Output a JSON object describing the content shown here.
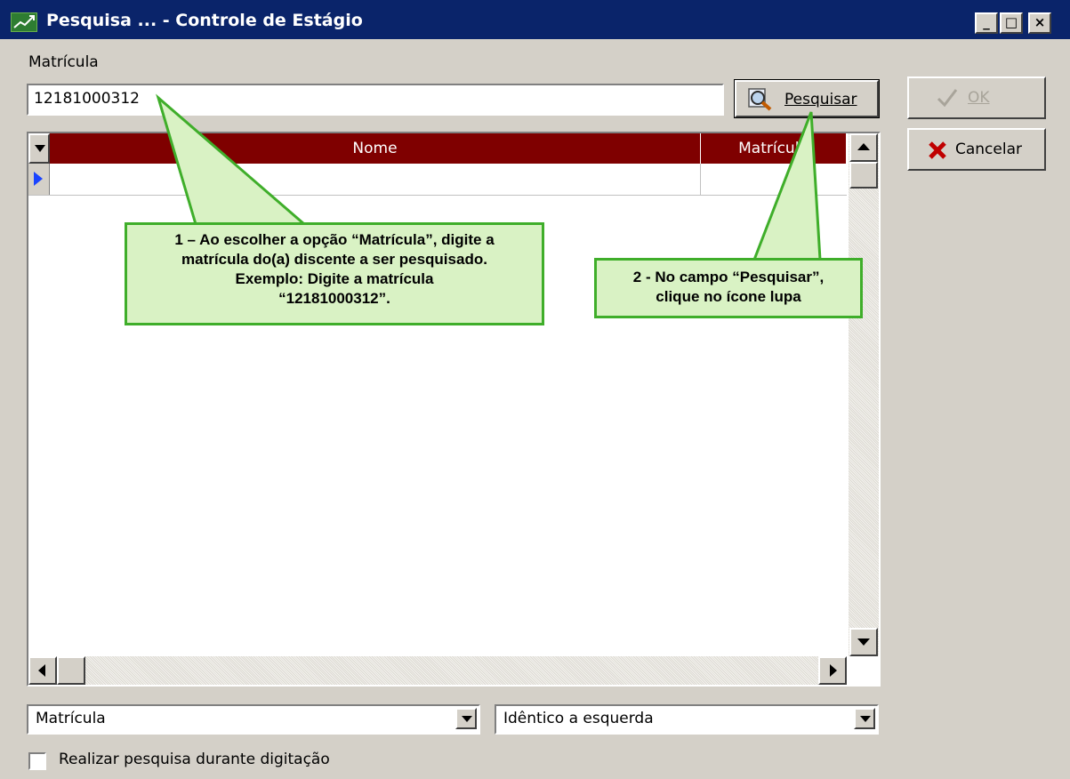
{
  "window": {
    "title": "Pesquisa ... - Controle de Estágio",
    "minimize_glyph": "_",
    "maximize_glyph": "□",
    "close_glyph": "×"
  },
  "search": {
    "field_label": "Matrícula",
    "input_value": "12181000312",
    "search_button_label": "Pesquisar",
    "search_icon": "magnifier-icon"
  },
  "actions": {
    "ok_label": "OK",
    "ok_enabled": false,
    "cancel_label": "Cancelar"
  },
  "grid": {
    "columns": [
      "Nome",
      "Matrícula"
    ],
    "rows": [
      [
        "",
        ""
      ]
    ],
    "header_color": "#7f0000"
  },
  "filters": {
    "field_select_value": "Matrícula",
    "match_select_value": "Idêntico a esquerda",
    "live_search_label": "Realizar pesquisa durante digitação",
    "live_search_checked": false
  },
  "annotations": [
    {
      "text": "1 – Ao escolher a opção “Matrícula”, digite a\nmatrícula do(a) discente a ser pesquisado.\nExemplo: Digite a matrícula\n“12181000312”."
    },
    {
      "text": "2 - No campo “Pesquisar”,\nclique no ícone lupa"
    }
  ],
  "colors": {
    "titlebar": "#0a246a",
    "window_bg": "#d4d0c8",
    "callout_fill": "#d9f2c4",
    "callout_border": "#3fae2a"
  }
}
